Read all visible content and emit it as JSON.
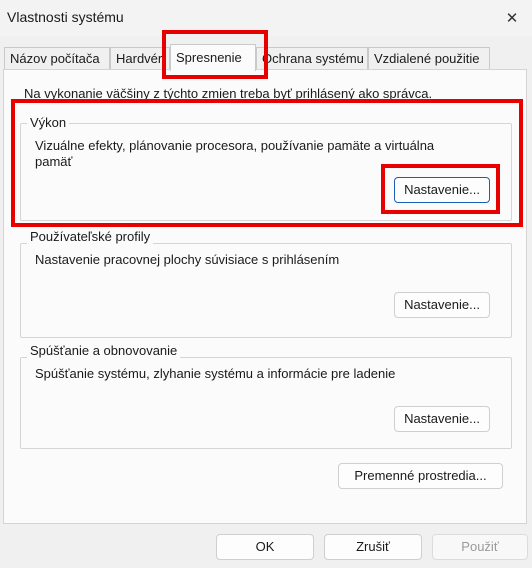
{
  "window": {
    "title": "Vlastnosti systému",
    "close_glyph": "✕"
  },
  "tabs": [
    {
      "label": "Názov počítača"
    },
    {
      "label": "Hardvér"
    },
    {
      "label": "Spresnenie",
      "active": true
    },
    {
      "label": "Ochrana systému"
    },
    {
      "label": "Vzdialené použitie"
    }
  ],
  "main": {
    "admin_note": "Na vykonanie väčšiny z týchto zmien treba byť prihlásený ako správca.",
    "performance": {
      "label": "Výkon",
      "description": "Vizuálne efekty, plánovanie procesora, používanie pamäte a virtuálna pamäť",
      "button": "Nastavenie..."
    },
    "user_profiles": {
      "label": "Používateľské profily",
      "description": "Nastavenie pracovnej plochy súvisiace s prihlásením",
      "button": "Nastavenie..."
    },
    "startup_recovery": {
      "label": "Spúšťanie a obnovovanie",
      "description": "Spúšťanie systému, zlyhanie systému a informácie pre ladenie",
      "button": "Nastavenie..."
    },
    "env_button": "Premenné prostredia..."
  },
  "footer": {
    "ok": "OK",
    "cancel": "Zrušiť",
    "apply": "Použiť"
  },
  "colors": {
    "highlight": "#e60000",
    "focus_border": "#1a5fb4"
  }
}
